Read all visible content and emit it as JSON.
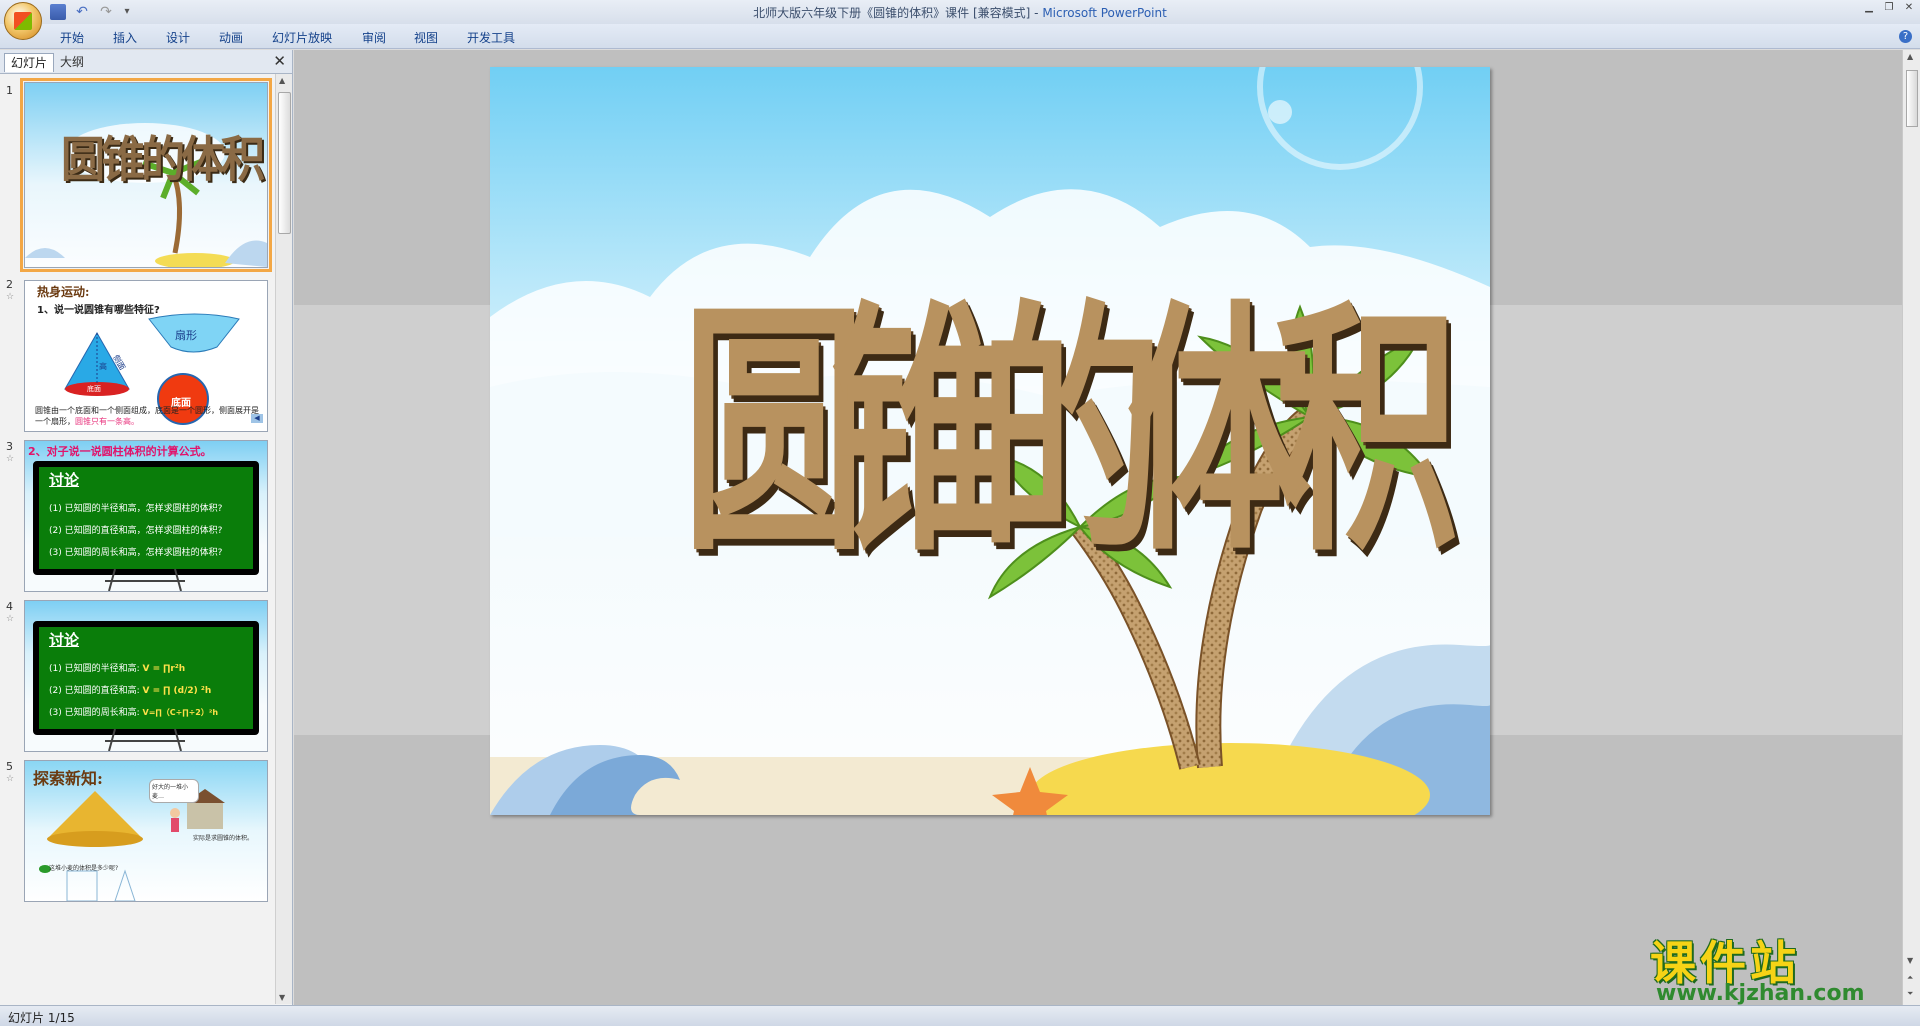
{
  "window": {
    "title_prefix": "北师大版六年级下册《圆锥的体积》课件 [兼容模式] - ",
    "title_app": "Microsoft PowerPoint"
  },
  "ribbon": {
    "tabs": [
      "开始",
      "插入",
      "设计",
      "动画",
      "幻灯片放映",
      "审阅",
      "视图",
      "开发工具"
    ]
  },
  "panel": {
    "tab_slides": "幻灯片",
    "tab_outline": "大纲",
    "close": "✕"
  },
  "slides": [
    {
      "num": "1",
      "title": "圆锥的体积"
    },
    {
      "num": "2",
      "heading": "热身运动:",
      "question": "1、说一说圆锥有哪些特征?",
      "fan_label": "扇形",
      "base_label": "底面",
      "side_label": "侧面",
      "height_label": "高",
      "base2_label": "底面",
      "caption_a": "圆锥由一个底面和一个侧面组成，底面是一个圆形，侧面展开是一个扇形，",
      "caption_b": "圆锥只有一条高。"
    },
    {
      "num": "3",
      "heading": "2、对子说一说圆柱体积的计算公式。",
      "board_title": "讨论",
      "lines": [
        "(1) 已知圆的半径和高，怎样求圆柱的体积?",
        "(2) 已知圆的直径和高，怎样求圆柱的体积?",
        "(3) 已知圆的周长和高，怎样求圆柱的体积?"
      ]
    },
    {
      "num": "4",
      "board_title": "讨论",
      "lines": [
        "(1) 已知圆的半径和高:",
        "(2) 已知圆的直径和高:",
        "(3) 已知圆的周长和高:"
      ],
      "formulas": [
        "V = ∏r²h",
        "V = ∏ (d/2) ²h",
        "V=∏（C÷∏÷2）²h"
      ]
    },
    {
      "num": "5",
      "heading": "探索新知:",
      "bubble": "好大的一堆小麦…",
      "note": "这堆小麦的体积是多少呢?",
      "note2": "实际是求圆锥的体积。"
    }
  ],
  "main_slide": {
    "title": "圆锥的体积"
  },
  "status": {
    "text": "幻灯片 1/15"
  },
  "watermark": {
    "big": "课件站",
    "small": "www.kjzhan.com"
  },
  "colors": {
    "ribbon_text": "#15428b",
    "selected_outline": "#f3a745",
    "sky": "#8fd6f5",
    "board": "#0a7d0a"
  }
}
